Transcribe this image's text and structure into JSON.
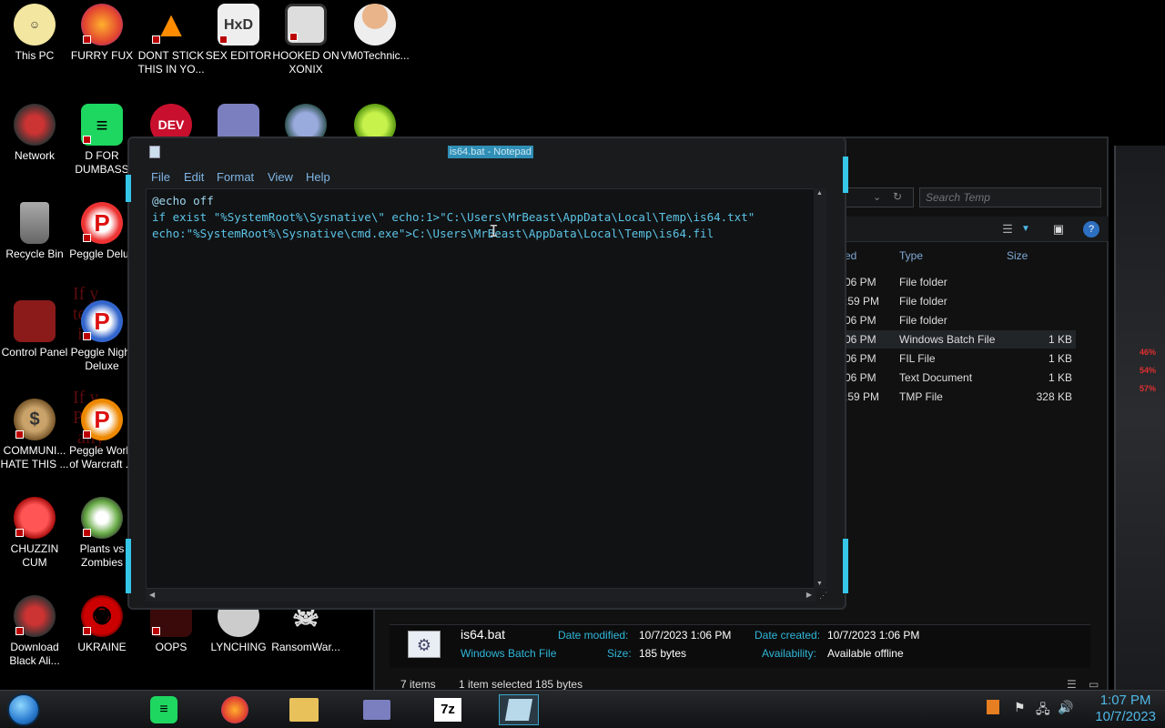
{
  "desktop": {
    "icons": [
      {
        "label": "This PC"
      },
      {
        "label": "FURRY FUX"
      },
      {
        "label": "DONT STICK THIS IN YO..."
      },
      {
        "label": "SEX EDITOR"
      },
      {
        "label": "HOOKED ON XONIX"
      },
      {
        "label": "VM0Technic..."
      },
      {
        "label": "Network"
      },
      {
        "label": "D FOR DUMBASS"
      },
      {
        "label": "Recycle Bin"
      },
      {
        "label": "Peggle Delux"
      },
      {
        "label": "Control Panel"
      },
      {
        "label": "Peggle Night Deluxe"
      },
      {
        "label": "COMMUNI... HATE THIS ..."
      },
      {
        "label": "Peggle World of Warcraft ..."
      },
      {
        "label": "CHUZZIN CUM"
      },
      {
        "label": "Plants vs Zombies"
      },
      {
        "label": "Download Black Ali..."
      },
      {
        "label": "UKRAINE"
      },
      {
        "label": "OOPS"
      },
      {
        "label": "LYNCHING"
      },
      {
        "label": "RansomWar..."
      }
    ]
  },
  "notepad": {
    "title": "is64.bat - Notepad",
    "menu": [
      "File",
      "Edit",
      "Format",
      "View",
      "Help"
    ],
    "lines": [
      "@echo off",
      "if exist \"%SystemRoot%\\Sysnative\\\" echo:1>\"C:\\Users\\MrBeast\\AppData\\Local\\Temp\\is64.txt\"",
      "echo:\"%SystemRoot%\\Sysnative\\cmd.exe\">C:\\Users\\MrBeast\\AppData\\Local\\Temp\\is64.fil"
    ]
  },
  "explorer": {
    "search_placeholder": "Search Temp",
    "columns": {
      "modified": "ed",
      "type": "Type",
      "size": "Size"
    },
    "rows": [
      {
        "time": "06 PM",
        "type": "File folder",
        "size": ""
      },
      {
        "time": ":59 PM",
        "type": "File folder",
        "size": ""
      },
      {
        "time": "06 PM",
        "type": "File folder",
        "size": ""
      },
      {
        "time": "06 PM",
        "type": "Windows Batch File",
        "size": "1 KB"
      },
      {
        "time": "06 PM",
        "type": "FIL File",
        "size": "1 KB"
      },
      {
        "time": "06 PM",
        "type": "Text Document",
        "size": "1 KB"
      },
      {
        "time": ":59 PM",
        "type": "TMP File",
        "size": "328 KB"
      }
    ],
    "details": {
      "filename": "is64.bat",
      "filetype": "Windows Batch File",
      "date_modified_label": "Date modified:",
      "date_modified": "10/7/2023 1:06 PM",
      "size_label": "Size:",
      "size": "185 bytes",
      "date_created_label": "Date created:",
      "date_created": "10/7/2023 1:06 PM",
      "availability_label": "Availability:",
      "availability": "Available offline"
    },
    "status": {
      "items": "7 items",
      "selected": "1 item selected  185 bytes"
    }
  },
  "right_gauges": [
    "46%",
    "54%",
    "57%"
  ],
  "taskbar": {
    "sevenzip_label": "7z",
    "time": "1:07 PM",
    "date": "10/7/2023"
  },
  "colors": {
    "accent": "#35c6e8",
    "text_cyan": "#5bc4e6",
    "menu_blue": "#7fb6e6"
  }
}
